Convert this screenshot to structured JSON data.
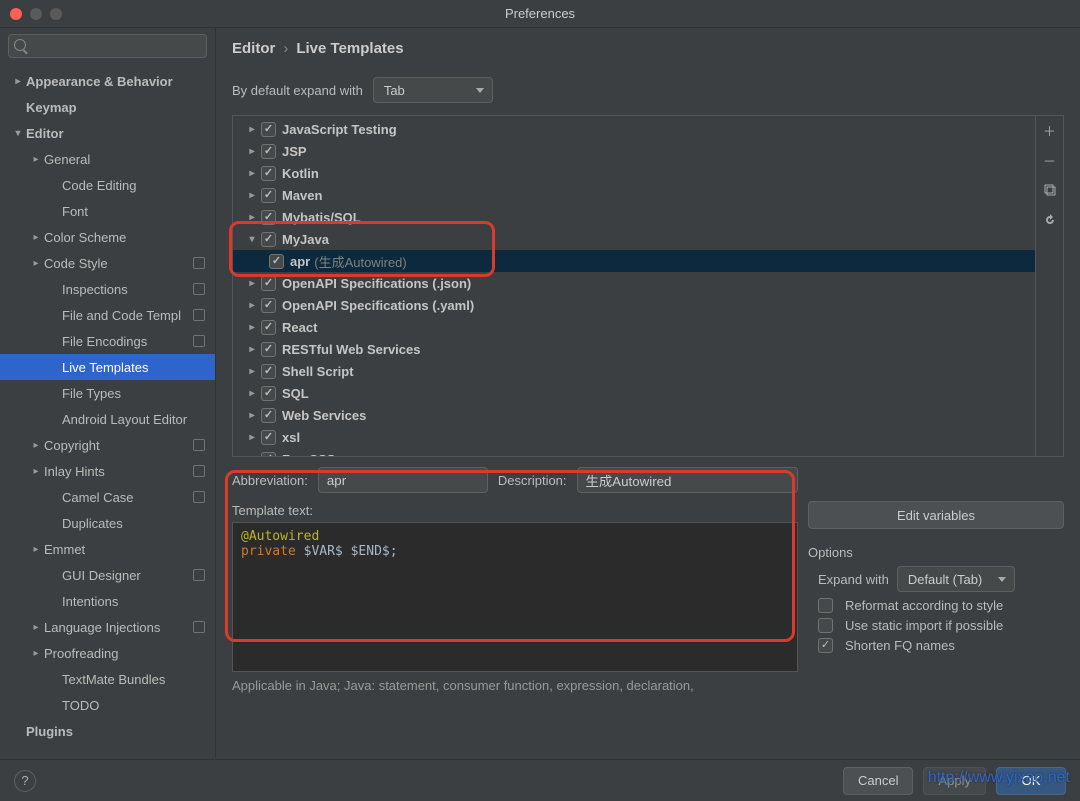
{
  "window": {
    "title": "Preferences"
  },
  "sidebar": {
    "search_placeholder": "",
    "items": [
      {
        "label": "Appearance & Behavior",
        "level": 0,
        "chev": "right",
        "bold": true
      },
      {
        "label": "Keymap",
        "level": 0,
        "chev": "none",
        "bold": true
      },
      {
        "label": "Editor",
        "level": 0,
        "chev": "down",
        "bold": true
      },
      {
        "label": "General",
        "level": 1,
        "chev": "right"
      },
      {
        "label": "Code Editing",
        "level": 2,
        "chev": "none"
      },
      {
        "label": "Font",
        "level": 2,
        "chev": "none"
      },
      {
        "label": "Color Scheme",
        "level": 1,
        "chev": "right"
      },
      {
        "label": "Code Style",
        "level": 1,
        "chev": "right",
        "badge": true
      },
      {
        "label": "Inspections",
        "level": 2,
        "chev": "none",
        "badge": true
      },
      {
        "label": "File and Code Templ",
        "level": 2,
        "chev": "none",
        "badge": true
      },
      {
        "label": "File Encodings",
        "level": 2,
        "chev": "none",
        "badge": true
      },
      {
        "label": "Live Templates",
        "level": 2,
        "chev": "none",
        "selected": true
      },
      {
        "label": "File Types",
        "level": 2,
        "chev": "none"
      },
      {
        "label": "Android Layout Editor",
        "level": 2,
        "chev": "none"
      },
      {
        "label": "Copyright",
        "level": 1,
        "chev": "right",
        "badge": true
      },
      {
        "label": "Inlay Hints",
        "level": 1,
        "chev": "right",
        "badge": true
      },
      {
        "label": "Camel Case",
        "level": 2,
        "chev": "none",
        "badge": true
      },
      {
        "label": "Duplicates",
        "level": 2,
        "chev": "none"
      },
      {
        "label": "Emmet",
        "level": 1,
        "chev": "right"
      },
      {
        "label": "GUI Designer",
        "level": 2,
        "chev": "none",
        "badge": true
      },
      {
        "label": "Intentions",
        "level": 2,
        "chev": "none"
      },
      {
        "label": "Language Injections",
        "level": 1,
        "chev": "right",
        "badge": true
      },
      {
        "label": "Proofreading",
        "level": 1,
        "chev": "right"
      },
      {
        "label": "TextMate Bundles",
        "level": 2,
        "chev": "none"
      },
      {
        "label": "TODO",
        "level": 2,
        "chev": "none"
      },
      {
        "label": "Plugins",
        "level": 0,
        "chev": "none",
        "bold": true
      }
    ]
  },
  "breadcrumb": {
    "a": "Editor",
    "b": "Live Templates"
  },
  "expand": {
    "label": "By default expand with",
    "value": "Tab"
  },
  "templates": [
    {
      "label": "JavaScript Testing",
      "chev": "right",
      "checked": true
    },
    {
      "label": "JSP",
      "chev": "right",
      "checked": true
    },
    {
      "label": "Kotlin",
      "chev": "right",
      "checked": true
    },
    {
      "label": "Maven",
      "chev": "right",
      "checked": true
    },
    {
      "label": "Mybatis/SQL",
      "chev": "right",
      "checked": true
    },
    {
      "label": "MyJava",
      "chev": "down",
      "checked": true,
      "expanded": true
    },
    {
      "label": "apr",
      "desc": "(生成Autowired)",
      "sub": true,
      "checked": true,
      "selected": true
    },
    {
      "label": "OpenAPI Specifications (.json)",
      "chev": "right",
      "checked": true
    },
    {
      "label": "OpenAPI Specifications (.yaml)",
      "chev": "right",
      "checked": true
    },
    {
      "label": "React",
      "chev": "right",
      "checked": true
    },
    {
      "label": "RESTful Web Services",
      "chev": "right",
      "checked": true
    },
    {
      "label": "Shell Script",
      "chev": "right",
      "checked": true
    },
    {
      "label": "SQL",
      "chev": "right",
      "checked": true
    },
    {
      "label": "Web Services",
      "chev": "right",
      "checked": true
    },
    {
      "label": "xsl",
      "chev": "right",
      "checked": true
    },
    {
      "label": "Zen CSS",
      "chev": "right",
      "checked": true
    }
  ],
  "detail": {
    "abbrev_label": "Abbreviation:",
    "abbrev_value": "apr",
    "desc_label": "Description:",
    "desc_value": "生成Autowired",
    "template_label": "Template text:",
    "template_code_line1": "@Autowired",
    "template_code_line2a": "private",
    "template_code_line2b": " $VAR$ $END$;",
    "edit_vars": "Edit variables",
    "options_title": "Options",
    "expand_label": "Expand with",
    "expand_value": "Default (Tab)",
    "opt1": "Reformat according to style",
    "opt2": "Use static import if possible",
    "opt3": "Shorten FQ names",
    "opt3_checked": true
  },
  "applicable": "Applicable in Java; Java: statement, consumer function, expression, declaration,",
  "footer": {
    "cancel": "Cancel",
    "apply": "Apply",
    "ok": "OK"
  },
  "watermark": "http://www.yixao.net"
}
